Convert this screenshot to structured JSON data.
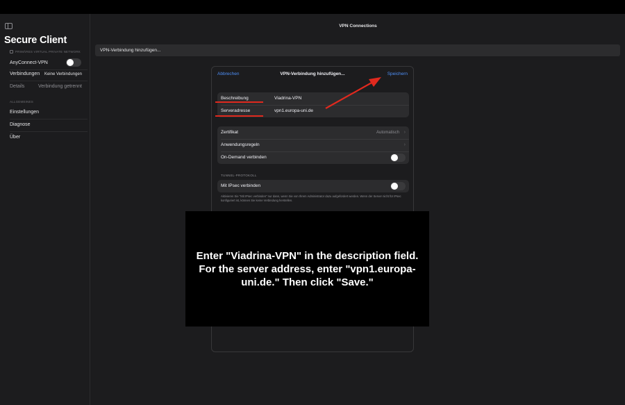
{
  "window": {
    "title": "VPN Connections"
  },
  "sidebar": {
    "app_title": "Secure Client",
    "section_primary": "PRIMÄRES VIRTUAL PRIVATE NETWORK",
    "vpn_label": "AnyConnect-VPN",
    "connections_label": "Verbindungen",
    "connections_value": "Keine Verbindungen",
    "details_label": "Details",
    "details_value": "Verbindung getrennt",
    "section_general": "ALLGEMEINES",
    "items": [
      {
        "label": "Einstellungen"
      },
      {
        "label": "Diagnose"
      },
      {
        "label": "Über"
      }
    ]
  },
  "main": {
    "add_connection_label": "VPN-Verbindung hinzufügen..."
  },
  "modal": {
    "cancel_label": "Abbrechen",
    "title": "VPN-Verbindung hinzufügen...",
    "save_label": "Speichern",
    "description_label": "Beschreibung",
    "description_value": "Viadrina-VPN",
    "server_label": "Serveradresse",
    "server_value": "vpn1.europa-uni.de",
    "certificate_label": "Zertifikat",
    "certificate_value": "Automatisch",
    "app_rules_label": "Anwendungsregeln",
    "on_demand_label": "On-Demand verbinden",
    "tunnel_section": "TUNNEL-PROTOKOLL",
    "ipsec_label": "Mit IPsec verbinden",
    "footnote": "Aktivieren Sie \"Mit IPsec verbinden\" nur dann, wenn Sie von Ihrem Administrator dazu aufgefordert werden. Wenn der Server nicht für IPsec konfiguriert ist, können Sie keine Verbindung herstellen."
  },
  "overlay": {
    "instruction": "Enter \"Viadrina-VPN\" in the description field. For the server address, enter \"vpn1.europa-uni.de.\" Then click \"Save.\""
  },
  "colors": {
    "accent": "#4e8ff7",
    "annotation": "#e0291e",
    "background": "#1c1c1e"
  }
}
